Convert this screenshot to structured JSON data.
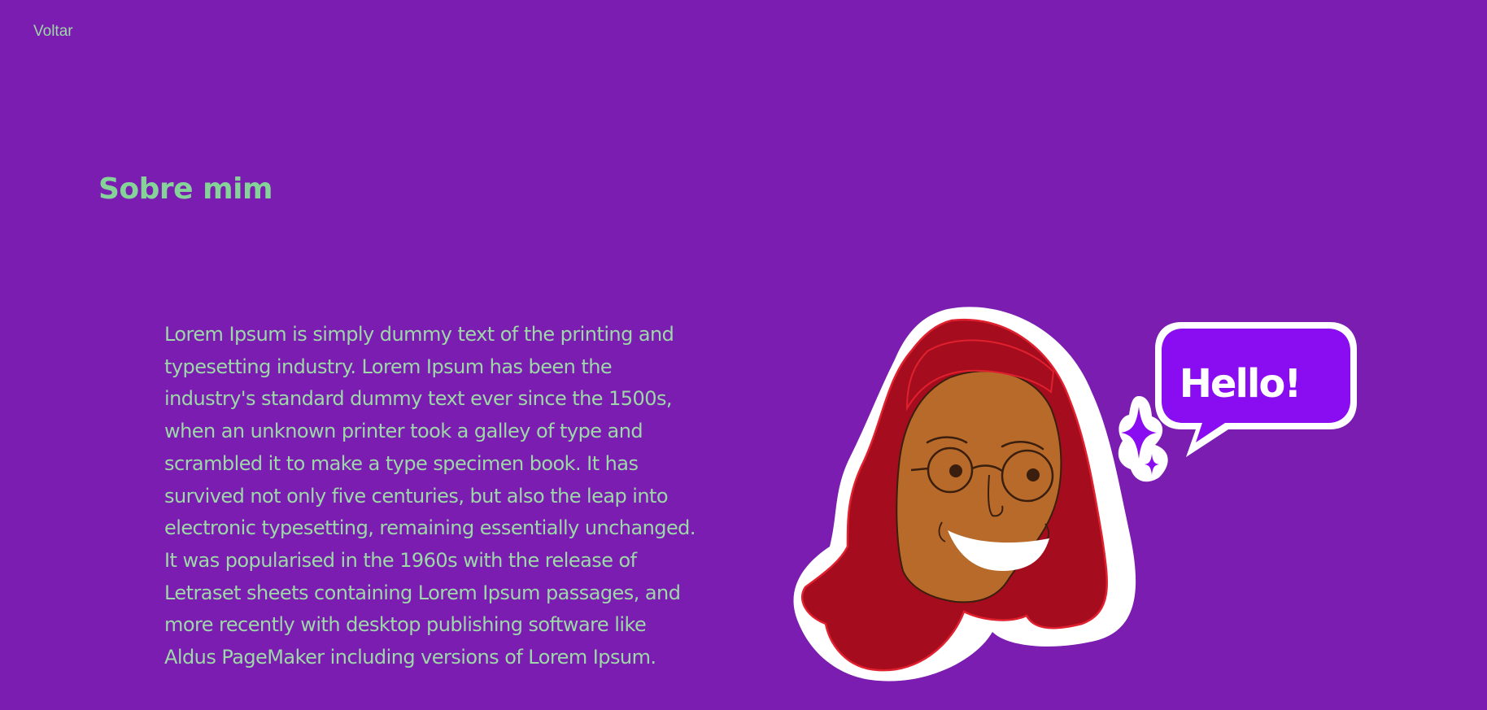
{
  "nav": {
    "back_label": "Voltar"
  },
  "about": {
    "title": "Sobre mim",
    "body": "Lorem Ipsum is simply dummy text of the printing and typesetting industry. Lorem Ipsum has been the industry's standard dummy text ever since the 1500s, when an unknown printer took a galley of type and scrambled it to make a type specimen book. It has survived not only five centuries, but also the leap into electronic typesetting, remaining essentially unchanged. It was popularised in the 1960s with the release of Letraset sheets containing Lorem Ipsum passages, and more recently with desktop publishing software like Aldus PageMaker including versions of Lorem Ipsum."
  },
  "illustration": {
    "speech_bubble_text": "Hello!"
  },
  "colors": {
    "background": "#7a1db0",
    "title": "#86d39a",
    "text": "#9ed7a8",
    "hair": "#a50d1e",
    "skin": "#b86a2a",
    "bubble": "#8a0cf0"
  }
}
